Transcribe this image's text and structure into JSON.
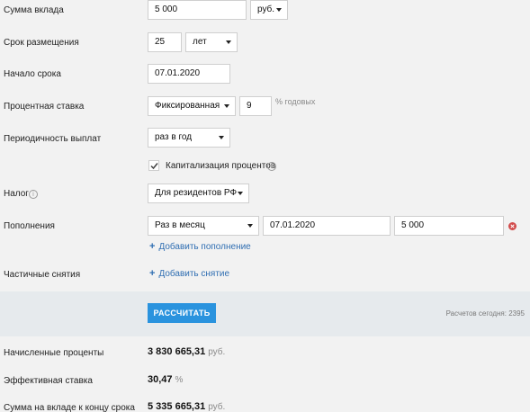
{
  "deposit_amount": {
    "label": "Сумма вклада",
    "value": "5 000",
    "currency": "руб."
  },
  "term": {
    "label": "Срок размещения",
    "value": "25",
    "unit": "лет"
  },
  "start_date": {
    "label": "Начало срока",
    "value": "07.01.2020"
  },
  "interest_rate": {
    "label": "Процентная ставка",
    "type": "Фиксированная",
    "value": "9",
    "suffix": "% годовых"
  },
  "payout_frequency": {
    "label": "Периодичность выплат",
    "value": "раз в год"
  },
  "capitalization": {
    "label": "Капитализация процентов",
    "checked": true,
    "info_icon": "info-icon"
  },
  "tax": {
    "label": "Налог",
    "value": "Для резидентов РФ",
    "info_icon": "info-icon"
  },
  "replenishments": {
    "label": "Пополнения",
    "frequency": "Раз в месяц",
    "date": "07.01.2020",
    "amount": "5 000",
    "add_link": "Добавить пополнение",
    "plus_icon": "+"
  },
  "withdrawals": {
    "label": "Частичные снятия",
    "add_link": "Добавить снятие",
    "plus_icon": "+"
  },
  "calculate": {
    "button": "РАССЧИТАТЬ",
    "count_text": "Расчетов сегодня: 2395"
  },
  "results": {
    "accrued_interest": {
      "label": "Начисленные проценты",
      "value": "3 830 665,31",
      "unit": "руб."
    },
    "effective_rate": {
      "label": "Эффективная ставка",
      "value": "30,47",
      "unit": "%"
    },
    "final_amount": {
      "label": "Сумма на вкладе к концу срока",
      "value": "5 335 665,31",
      "unit": "руб."
    }
  },
  "colors": {
    "accent": "#2a93de",
    "link": "#2f6eb2",
    "remove": "#d24b4b",
    "band": "#e6eaed",
    "background": "#f2f2f2"
  }
}
